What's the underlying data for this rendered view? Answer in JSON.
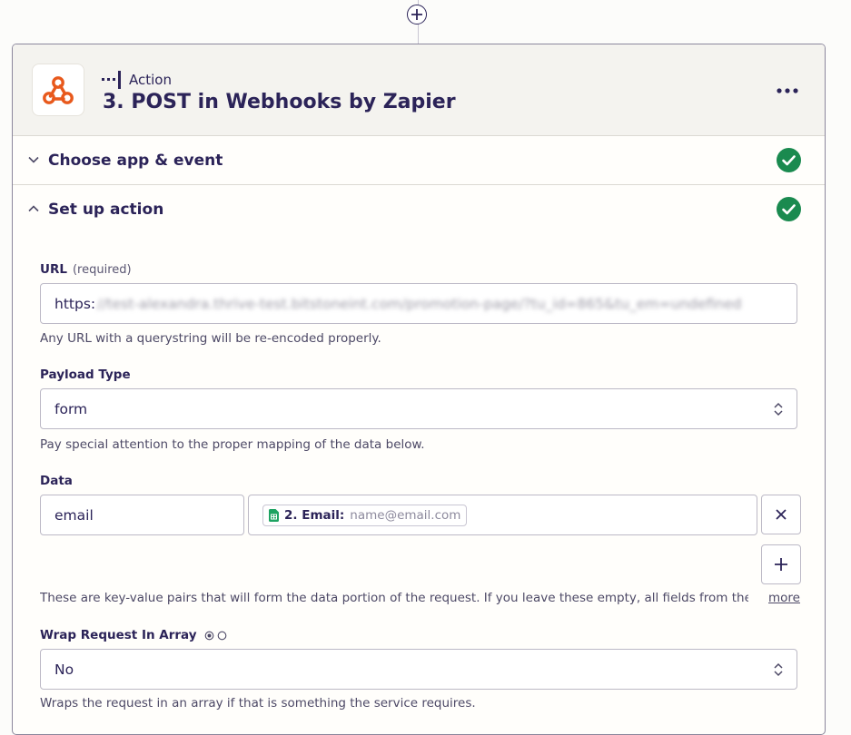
{
  "add_step": {
    "icon": "plus-icon"
  },
  "step": {
    "type_label": "Action",
    "title": "3. POST in Webhooks by Zapier",
    "app_icon": "webhook-icon",
    "brand_color": "#e8591c",
    "menu_icon": "more-horizontal-icon"
  },
  "sections": {
    "choose_app": {
      "label": "Choose app & event",
      "status_icon": "check-circle-icon",
      "status_color": "#1a8a4f"
    },
    "setup_action": {
      "label": "Set up action",
      "status_icon": "check-circle-icon",
      "status_color": "#1a8a4f"
    }
  },
  "url_field": {
    "label": "URL",
    "required_label": "(required)",
    "value_prefix": "https:",
    "value_blurred": "//test-alexandra.thrive-test.bitstoneint.com/promotion-page/?tu_id=865&tu_em=undefined",
    "help": "Any URL with a querystring will be re-encoded properly."
  },
  "payload_type": {
    "label": "Payload Type",
    "value": "form",
    "help": "Pay special attention to the proper mapping of the data below."
  },
  "data_field": {
    "label": "Data",
    "key": "email",
    "pill_key": "2. Email:",
    "pill_value": "name@email.com",
    "pill_icon": "google-sheets-icon",
    "help": "These are key-value pairs that will form the data portion of the request. If you leave these empty, all fields from the...",
    "more_label": "more"
  },
  "wrap_request": {
    "label": "Wrap Request In Array",
    "value": "No",
    "help": "Wraps the request in an array if that is something the service requires."
  }
}
